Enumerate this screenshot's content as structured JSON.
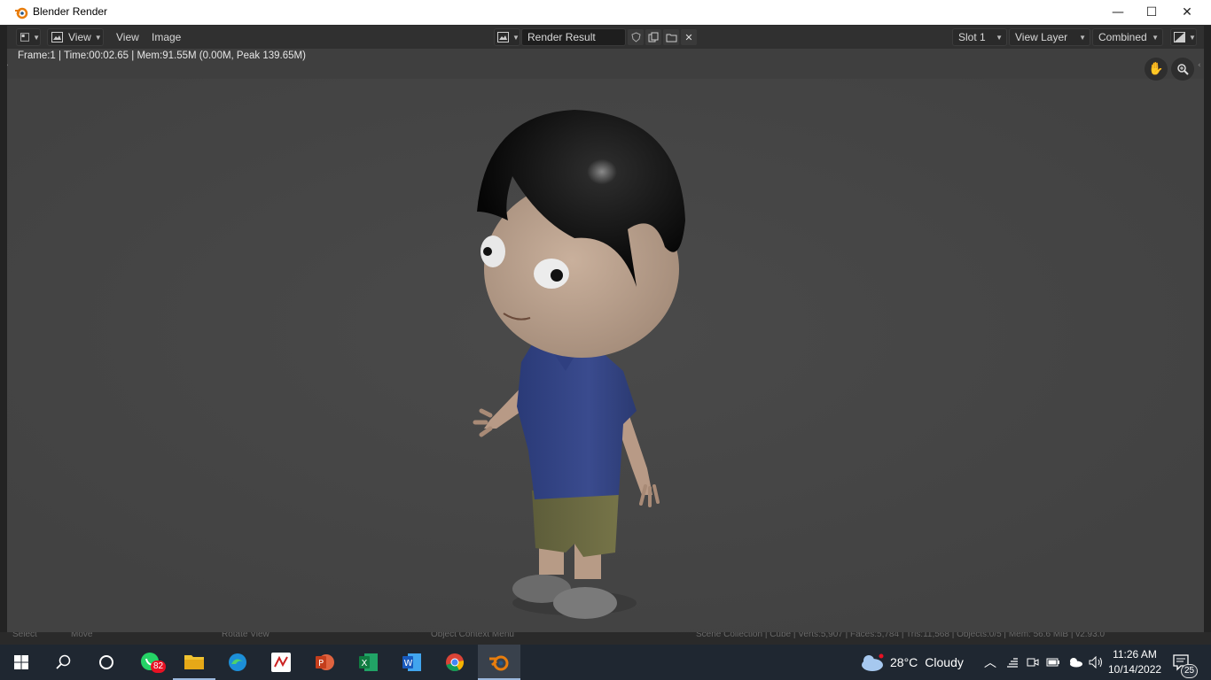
{
  "window": {
    "title": "Blender Render",
    "minimize": "—",
    "maximize": "☐",
    "close": "✕"
  },
  "header": {
    "menu_view_dropdown": "View",
    "menu_view": "View",
    "menu_image": "Image",
    "image_name": "Render Result",
    "slot": "Slot 1",
    "view_layer": "View Layer",
    "pass": "Combined"
  },
  "viewport": {
    "info": "Frame:1 | Time:00:02.65 | Mem:91.55M (0.00M, Peak 139.65M)"
  },
  "statusbar": {
    "select": "Select",
    "move": "Move",
    "rotate": "Rotate View",
    "context": "Object Context Menu",
    "stats": "Scene Collection | Cube | Verts:5,907 | Faces:5,784 | Tris:11,568 | Objects:0/5 | Mem: 56.6 MiB | v2.93.0"
  },
  "taskbar": {
    "whatsapp_badge": "82",
    "weather_temp": "28°C",
    "weather_desc": "Cloudy",
    "time": "11:26 AM",
    "date": "10/14/2022",
    "notifications": "25",
    "colors": {
      "bg": "#1f2731",
      "accent": "#9bb8dc"
    }
  }
}
